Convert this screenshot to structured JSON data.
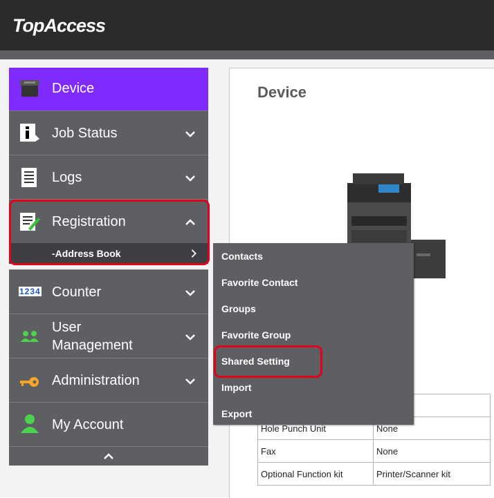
{
  "app": {
    "logo": "TopAccess"
  },
  "nav": {
    "device": "Device",
    "job_status": "Job Status",
    "logs": "Logs",
    "registration": "Registration",
    "address_book": "-Address Book",
    "counter": "Counter",
    "counter_icon_text": "1234",
    "user_management_1": "User",
    "user_management_2": "Management",
    "administration": "Administration",
    "my_account": "My Account"
  },
  "flyout": {
    "items": [
      "Contacts",
      "Favorite Contact",
      "Groups",
      "Favorite Group",
      "Shared Setting",
      "Import",
      "Export"
    ]
  },
  "main": {
    "title": "Device",
    "table": [
      [
        "",
        ""
      ],
      [
        "Hole Punch Unit",
        "None"
      ],
      [
        "Fax",
        "None"
      ],
      [
        "Optional Function kit",
        "Printer/Scanner kit"
      ]
    ]
  },
  "colors": {
    "accent": "#7f2bff",
    "highlight": "#e3001b",
    "nav_bg": "#5d5f63"
  }
}
